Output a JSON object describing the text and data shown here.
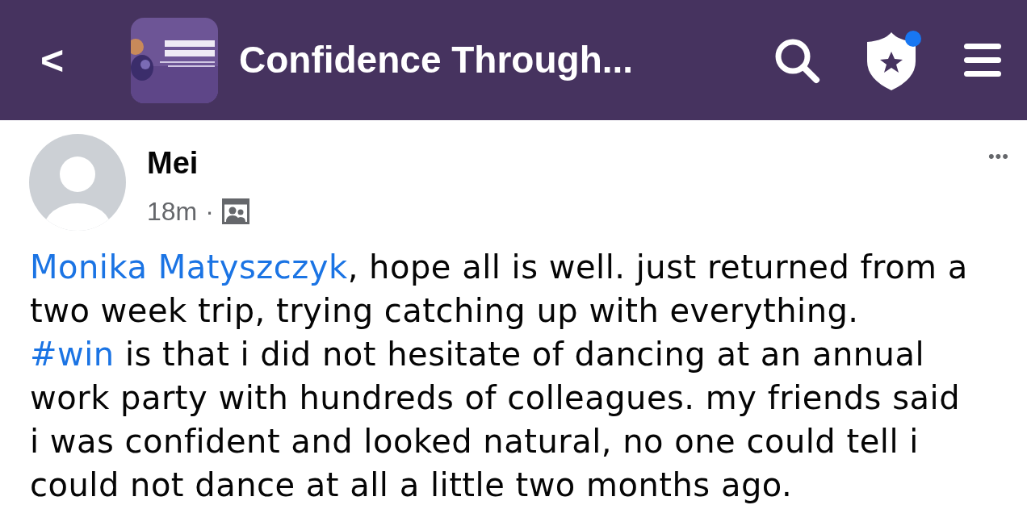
{
  "header": {
    "back": "<",
    "title": "Confidence Through...",
    "shield_notification": true
  },
  "post": {
    "author": "Mei",
    "time": "18m",
    "separator": "·",
    "more": "•••",
    "paragraphs": [
      [
        {
          "kind": "mention",
          "text": "Monika Matyszczyk"
        },
        {
          "kind": "text",
          "text": ", hope all is well. just returned from a two week trip, trying catching up with everything."
        }
      ],
      [
        {
          "kind": "hashtag",
          "text": "#win"
        },
        {
          "kind": "text",
          "text": " is that i did not hesitate of dancing at an annual work party with hundreds of colleagues. my friends said i was confident and looked natural, no one could tell i could not dance at all a little two months ago."
        }
      ]
    ]
  }
}
